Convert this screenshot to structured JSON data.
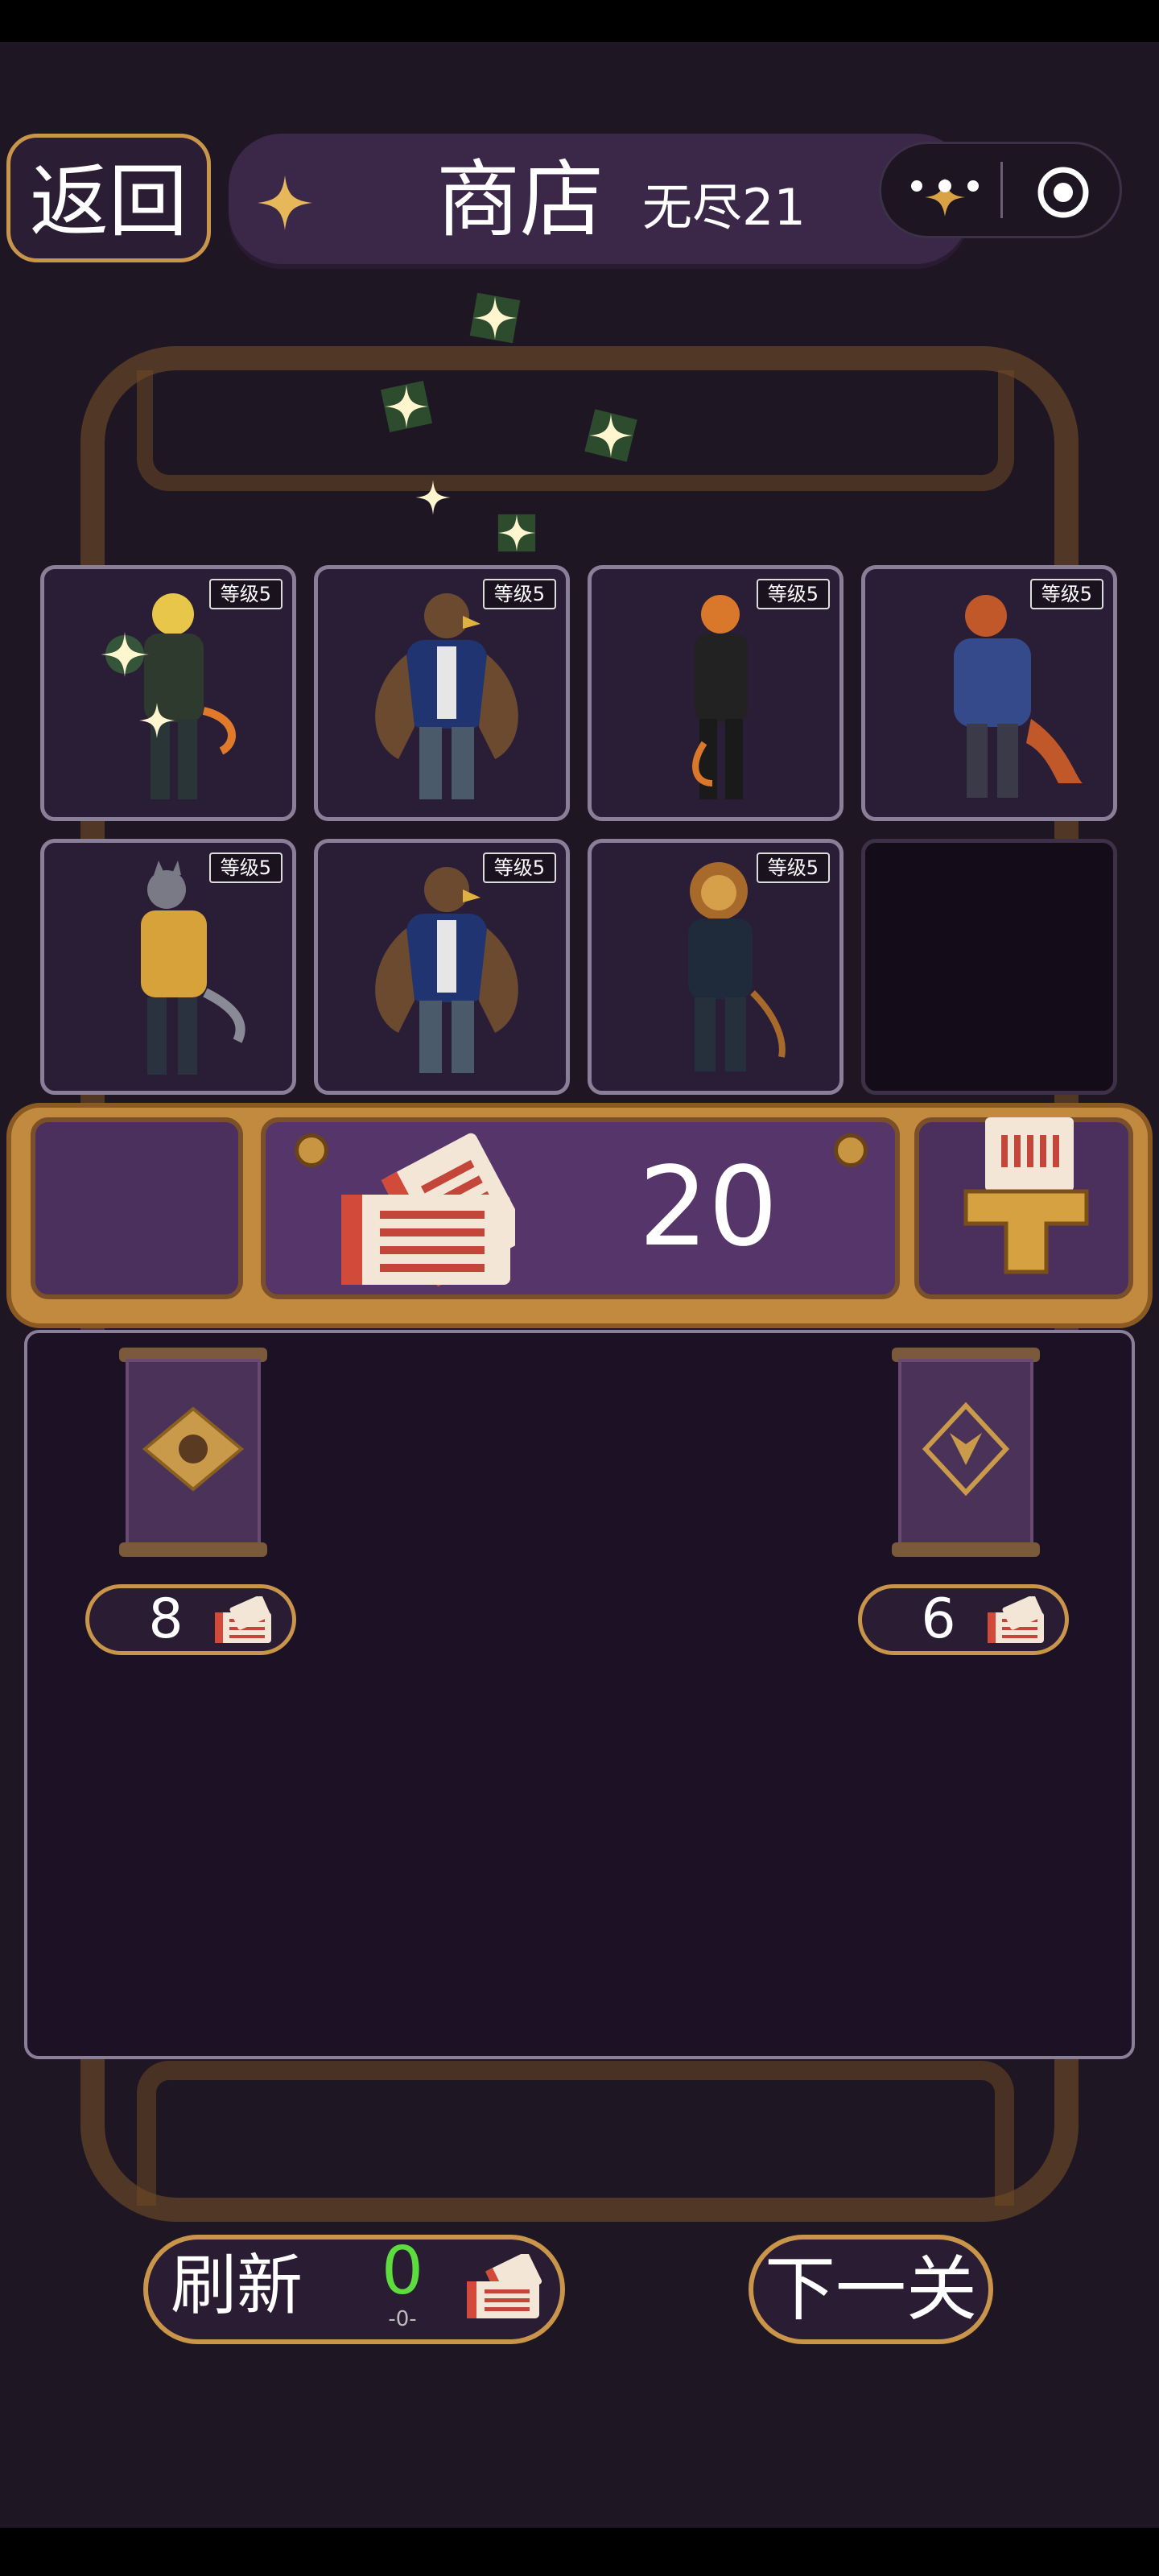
{
  "header": {
    "back_label": "返回",
    "title": "商店",
    "subtitle": "无尽21"
  },
  "characters": [
    {
      "level_label": "等级5",
      "animal": "cheetah",
      "jacket_color": "#2f3a2f",
      "highlighted": true
    },
    {
      "level_label": "等级5",
      "animal": "eagle",
      "jacket_color": "#1f3470"
    },
    {
      "level_label": "等级5",
      "animal": "tiger",
      "jacket_color": "#222222"
    },
    {
      "level_label": "等级5",
      "animal": "lizard",
      "jacket_color": "#344a8a"
    },
    {
      "level_label": "等级5",
      "animal": "wolf",
      "jacket_color": "#d7a23a"
    },
    {
      "level_label": "等级5",
      "animal": "eagle",
      "jacket_color": "#1f3470"
    },
    {
      "level_label": "等级5",
      "animal": "lion",
      "jacket_color": "#1f2a3a"
    },
    {
      "empty": true
    }
  ],
  "currency": {
    "amount": "20",
    "icon": "ticket-icon"
  },
  "shop_items": [
    {
      "price": "8",
      "icon": "scroll-emblem-icon"
    },
    {
      "price": "6",
      "icon": "scroll-demon-icon"
    }
  ],
  "refresh": {
    "label": "刷新",
    "cost": "0",
    "sub": "-0-"
  },
  "next_label": "下一关",
  "colors": {
    "gold": "#c9954a",
    "panel": "#1c1125",
    "refresh_cost": "#5ddc3e"
  }
}
